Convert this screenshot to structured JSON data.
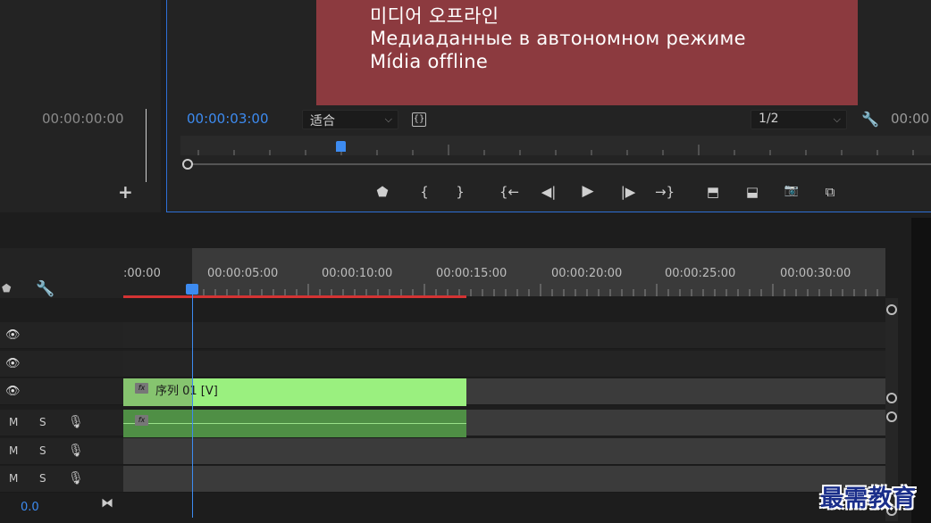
{
  "source_monitor": {
    "timecode": "00:00:00:00",
    "add_icon": "+"
  },
  "program_monitor": {
    "offline_lines": [
      "미디어 오프라인",
      "Медиаданные в автономном режиме",
      "Mídia offline"
    ],
    "timecode": "00:00:03:00",
    "fit_value": "适合",
    "resolution_value": "1/2",
    "right_timecode": "00:00",
    "transport": {
      "marker": "⬟",
      "mark_in": "{",
      "mark_out": "}",
      "go_in": "{←",
      "step_back": "◀|",
      "play": "▶",
      "step_fwd": "|▶",
      "go_out": "→}",
      "lift": "⬒",
      "extract": "⬓",
      "export_frame": "📷",
      "compare": "⧉"
    }
  },
  "timeline": {
    "ruler_labels": [
      ":00:00",
      "00:00:05:00",
      "00:00:10:00",
      "00:00:15:00",
      "00:00:20:00",
      "00:00:25:00",
      "00:00:30:00"
    ],
    "video_clip_label": "序列 01 [V]",
    "fx_label": "fx",
    "audio_track_buttons": {
      "mute": "M",
      "solo": "S"
    },
    "volume_readout": "0.0"
  },
  "watermark": "最需教育",
  "colors": {
    "accent": "#3d8bf0",
    "video_clip": "#9af07f",
    "audio_clip": "#4f8f45",
    "offline_bg": "#8c3a3f",
    "work_area": "#d43333"
  }
}
